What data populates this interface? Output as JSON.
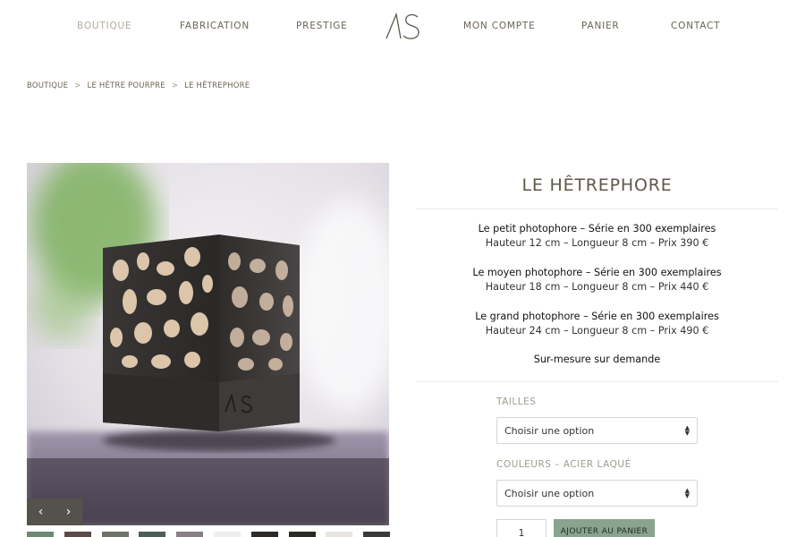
{
  "nav": {
    "left": [
      "BOUTIQUE",
      "FABRICATION",
      "PRESTIGE"
    ],
    "right": [
      "MON COMPTE",
      "PANIER",
      "CONTACT"
    ],
    "logo_text": "AS"
  },
  "breadcrumb": [
    "BOUTIQUE",
    "LE HÊTRE POURPRE",
    "LE HÊTREPHORE"
  ],
  "breadcrumb_separator": ">",
  "product": {
    "title": "LE HÊTREPHORE",
    "variants": [
      {
        "name": "Le petit photophore – Série en 300 exemplaires",
        "detail": "Hauteur 12 cm – Longueur 8 cm – Prix 390 €"
      },
      {
        "name": "Le moyen photophore – Série en 300 exemplaires",
        "detail": "Hauteur 18 cm – Longueur 8 cm – Prix 440 €"
      },
      {
        "name": "Le grand photophore – Série en 300 exemplaires",
        "detail": "Hauteur 24 cm – Longueur 8 cm – Prix 490 €"
      }
    ],
    "custom_note": "Sur-mesure sur demande",
    "image_logo_text": "AS"
  },
  "options": {
    "size_label": "TAILLES",
    "size_value": "Choisir une option",
    "color_label": "COULEURS – ACIER LAQUÉ",
    "color_value": "Choisir une option"
  },
  "cart": {
    "quantity": "1",
    "add_label": "AJOUTER AU PANIER"
  },
  "carousel": {
    "prev_icon": "chevron-left-icon",
    "next_icon": "chevron-right-icon",
    "prev_glyph": "‹",
    "next_glyph": "›"
  },
  "thumbnail_colors": [
    "#6f8a72",
    "#5b4c48",
    "#6e7468",
    "#4d5e57",
    "#8a7f86",
    "#eeeeee",
    "#2e2b26",
    "#2c2a27",
    "#e8e5e0",
    "#3a3a3a"
  ],
  "colors": {
    "accent": "#8aa38f",
    "nav_text": "#6b6453",
    "nav_active": "#b3ab9c",
    "title": "#5e5849"
  }
}
